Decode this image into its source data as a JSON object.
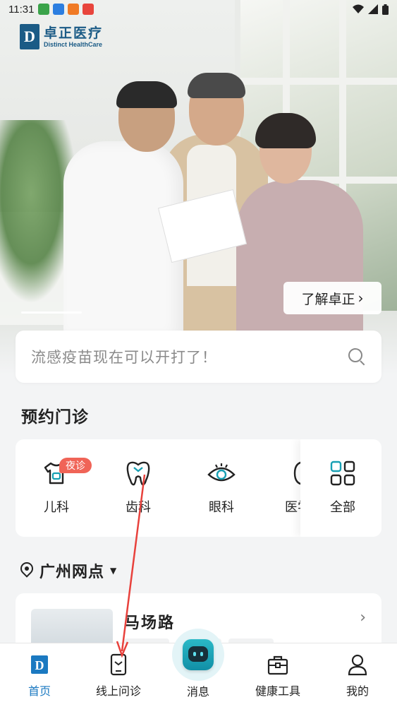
{
  "status_bar": {
    "time": "11:31"
  },
  "brand": {
    "name_cn": "卓正医疗",
    "name_en": "Distinct HealthCare",
    "mark": "D"
  },
  "hero": {
    "learn_more": "了解卓正"
  },
  "search": {
    "placeholder": "流感疫苗现在可以开打了！"
  },
  "appointment": {
    "title": "预约门诊",
    "departments": [
      {
        "label": "儿科",
        "icon": "shirt-icon",
        "badge": "夜诊"
      },
      {
        "label": "齿科",
        "icon": "tooth-icon"
      },
      {
        "label": "眼科",
        "icon": "eye-icon"
      },
      {
        "label": "医学",
        "icon": "medical-beauty-icon"
      }
    ],
    "all_label": "全部"
  },
  "branch": {
    "city": "广州网点"
  },
  "clinic": {
    "name": "马场路"
  },
  "bottom_nav": [
    {
      "label": "首页",
      "icon": "home-logo-icon",
      "active": true
    },
    {
      "label": "线上问诊",
      "icon": "tablet-consult-icon",
      "active": false
    },
    {
      "label": "消息",
      "icon": "robot-message-icon",
      "active": false
    },
    {
      "label": "健康工具",
      "icon": "toolbox-icon",
      "active": false
    },
    {
      "label": "我的",
      "icon": "person-icon",
      "active": false
    }
  ],
  "colors": {
    "brand": "#1b5b86",
    "accent_teal": "#1aa3b6",
    "active_blue": "#1b79c1",
    "badge_red": "#f06457",
    "annotation_red": "#e8413c"
  }
}
